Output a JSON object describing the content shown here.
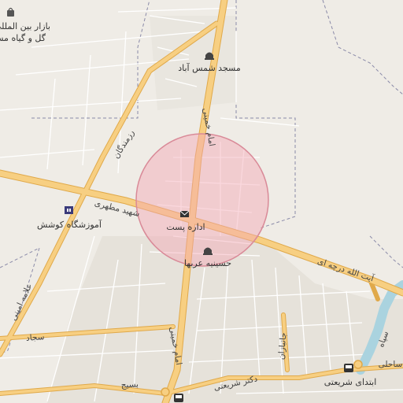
{
  "map": {
    "colors": {
      "land": "#efece6",
      "urban": "#e3dfd7",
      "major_road": "#f4c46a",
      "major_road_casing": "#e0a94a",
      "minor_road": "#ffffff",
      "water": "#aad3df",
      "boundary": "#8a8aa8",
      "highlight_fill": "#f3a6b3",
      "highlight_stroke": "#d98a98"
    },
    "pois": {
      "bazaar": {
        "label_1": "بازار بین المللی",
        "label_2": "گل و گیاه مس",
        "icon": "shopping-bag-icon"
      },
      "mosque_shams": {
        "label": "مسجد شمس آباد",
        "icon": "mosque-icon"
      },
      "school": {
        "label": "آموزشگاه کوشش",
        "icon": "school-icon"
      },
      "post_office": {
        "label": "اداره پست",
        "icon": "envelope-icon"
      },
      "hosseinieh": {
        "label": "حسینیه عربها",
        "icon": "mosque-icon"
      },
      "bus_stop": {
        "label": "ابتدای شریعتی",
        "icon": "bus-icon"
      }
    },
    "roads": {
      "motahari": "شهید مطهری",
      "ayatollah": "آیت الله درچه ای",
      "khomeini_north": "امام خمینی",
      "khomeini_south": "امام خمینی",
      "razmandegan": "رزمندگان",
      "allameh_amini": "علامه امینی",
      "sajjad": "سجاد",
      "shariati": "دکتر شریعتی",
      "basij": "بسیج",
      "jonbazan": "جانبازان",
      "sepah": "سپاه",
      "sahel": "ساحلی"
    }
  }
}
